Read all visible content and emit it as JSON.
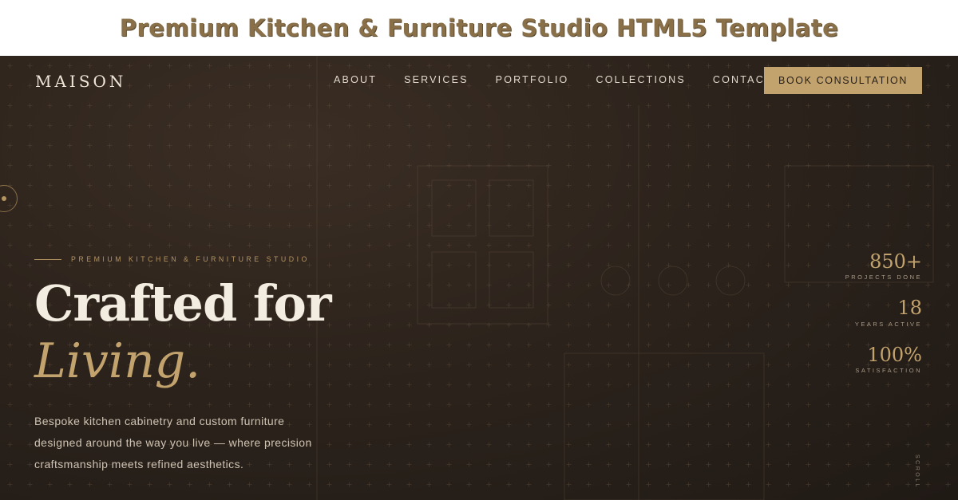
{
  "banner": {
    "title": "Premium Kitchen & Furniture Studio HTML5 Template"
  },
  "nav": {
    "logo": "MAISON",
    "links": [
      "ABOUT",
      "SERVICES",
      "PORTFOLIO",
      "COLLECTIONS",
      "CONTACT"
    ],
    "cta": "BOOK CONSULTATION"
  },
  "hero": {
    "eyebrow": "PREMIUM KITCHEN & FURNITURE STUDIO",
    "title": "Crafted for",
    "title_accent": "Living.",
    "description": "Bespoke kitchen cabinetry and custom furniture designed around the way you live — where precision craftsmanship meets refined aesthetics."
  },
  "stats": [
    {
      "value": "850+",
      "label": "PROJECTS DONE"
    },
    {
      "value": "18",
      "label": "YEARS ACTIVE"
    },
    {
      "value": "100%",
      "label": "SATISFACTION"
    }
  ],
  "scroll_label": "SCROLL",
  "colors": {
    "accent": "#c2a36d",
    "background": "#2c231c",
    "text": "#f3ece0"
  }
}
